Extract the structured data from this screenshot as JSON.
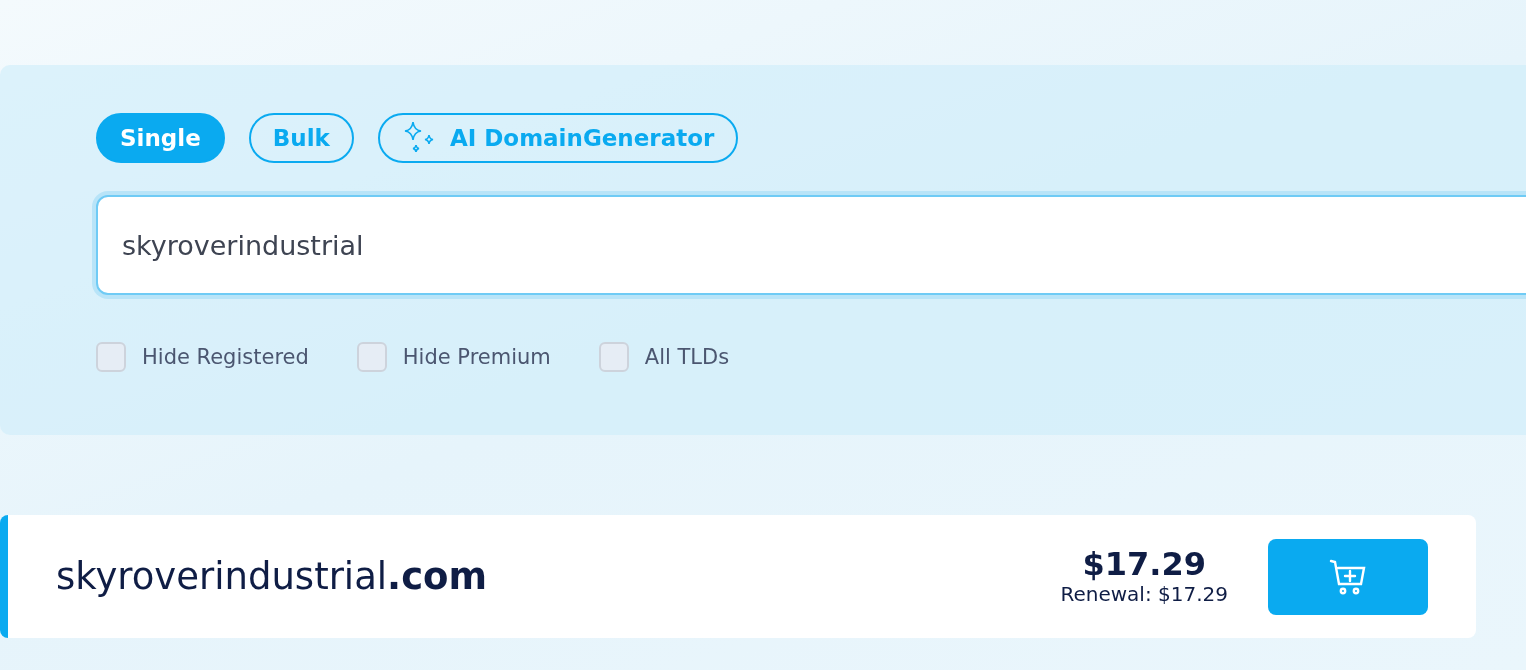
{
  "tabs": [
    {
      "label": "Single",
      "selected": true,
      "kind": "plain"
    },
    {
      "label": "Bulk",
      "selected": false,
      "kind": "plain"
    },
    {
      "label": "AI DomainGenerator",
      "selected": false,
      "kind": "ai"
    }
  ],
  "search": {
    "value": "skyroverindustrial"
  },
  "filters": [
    {
      "label": "Hide Registered",
      "checked": false
    },
    {
      "label": "Hide Premium",
      "checked": false
    },
    {
      "label": "All TLDs",
      "checked": false
    }
  ],
  "result": {
    "domain": "skyroverindustrial**.com**",
    "price": "$17.29",
    "renewal": "Renewal: $17.29"
  }
}
